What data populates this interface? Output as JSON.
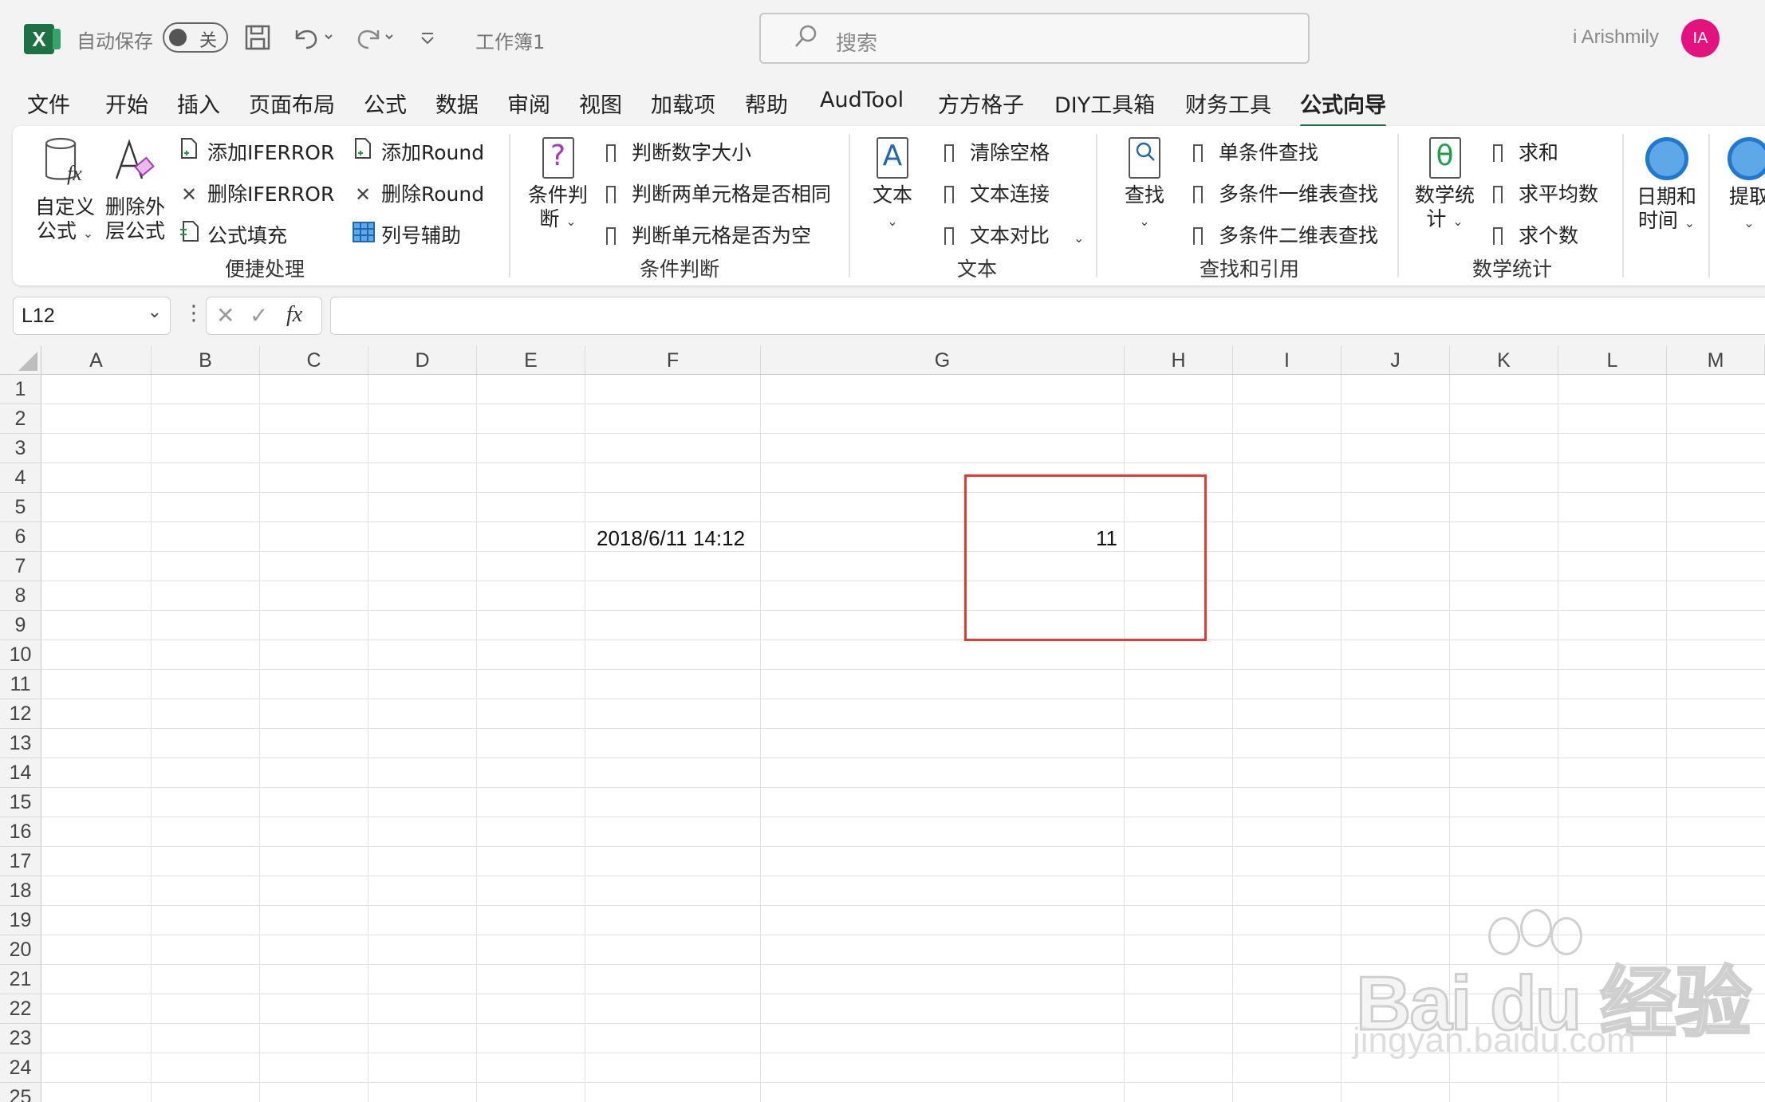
{
  "titlebar": {
    "autosave_label": "自动保存",
    "autosave_state": "关",
    "doc_title": "工作簿1",
    "search_placeholder": "搜索",
    "user_name": "i Arishmily",
    "avatar_initials": "IA",
    "app_logo": "X"
  },
  "menu_tabs": [
    "文件",
    "开始",
    "插入",
    "页面布局",
    "公式",
    "数据",
    "审阅",
    "视图",
    "加载项",
    "帮助",
    "AudTool",
    "方方格子",
    "DIY工具箱",
    "财务工具",
    "公式向导"
  ],
  "active_tab": "公式向导",
  "ribbon": {
    "groups": {
      "convenient": {
        "label": "便捷处理",
        "custom_formula": [
          "自定义",
          "公式"
        ],
        "remove_outer": [
          "删除外",
          "层公式"
        ],
        "add_iferror": "添加IFERROR",
        "remove_iferror": "删除IFERROR",
        "formula_fill": "公式填充",
        "add_round": "添加Round",
        "remove_round": "删除Round",
        "col_helper": "列号辅助"
      },
      "condition": {
        "label": "条件判断",
        "big_button": [
          "条件判",
          "断"
        ],
        "items": [
          "判断数字大小",
          "判断两单元格是否相同",
          "判断单元格是否为空"
        ]
      },
      "text": {
        "label": "文本",
        "big_button": "文本",
        "items": [
          "清除空格",
          "文本连接",
          "文本对比"
        ]
      },
      "lookup": {
        "label": "查找和引用",
        "big_button": "查找",
        "items": [
          "单条件查找",
          "多条件一维表查找",
          "多条件二维表查找"
        ]
      },
      "math": {
        "label": "数学统计",
        "big_button": [
          "数学统",
          "计"
        ],
        "items": [
          "求和",
          "求平均数",
          "求个数"
        ]
      },
      "datetime": {
        "big_button": [
          "日期和",
          "时间"
        ]
      },
      "extract": {
        "big_button": "提取"
      }
    }
  },
  "formula_bar": {
    "name_box": "L12",
    "fx_label": "fx",
    "formula": ""
  },
  "grid": {
    "columns": [
      "A",
      "B",
      "C",
      "D",
      "E",
      "F",
      "G",
      "H",
      "I",
      "J",
      "K",
      "L",
      "M"
    ],
    "rows": [
      "1",
      "2",
      "3",
      "4",
      "5",
      "6",
      "7",
      "8",
      "9",
      "10",
      "11",
      "12",
      "13",
      "14",
      "15",
      "16",
      "17",
      "18",
      "19",
      "20",
      "21",
      "22",
      "23",
      "24",
      "25"
    ],
    "cells": {
      "F6": "2018/6/11 14:12",
      "G6": "11"
    }
  },
  "watermark": {
    "brand": "Bai du 经验",
    "url": "jingyan.baidu.com"
  },
  "colors": {
    "excel_green": "#1e7145",
    "highlight_red": "#e53935",
    "avatar_pink": "#e3127e"
  }
}
